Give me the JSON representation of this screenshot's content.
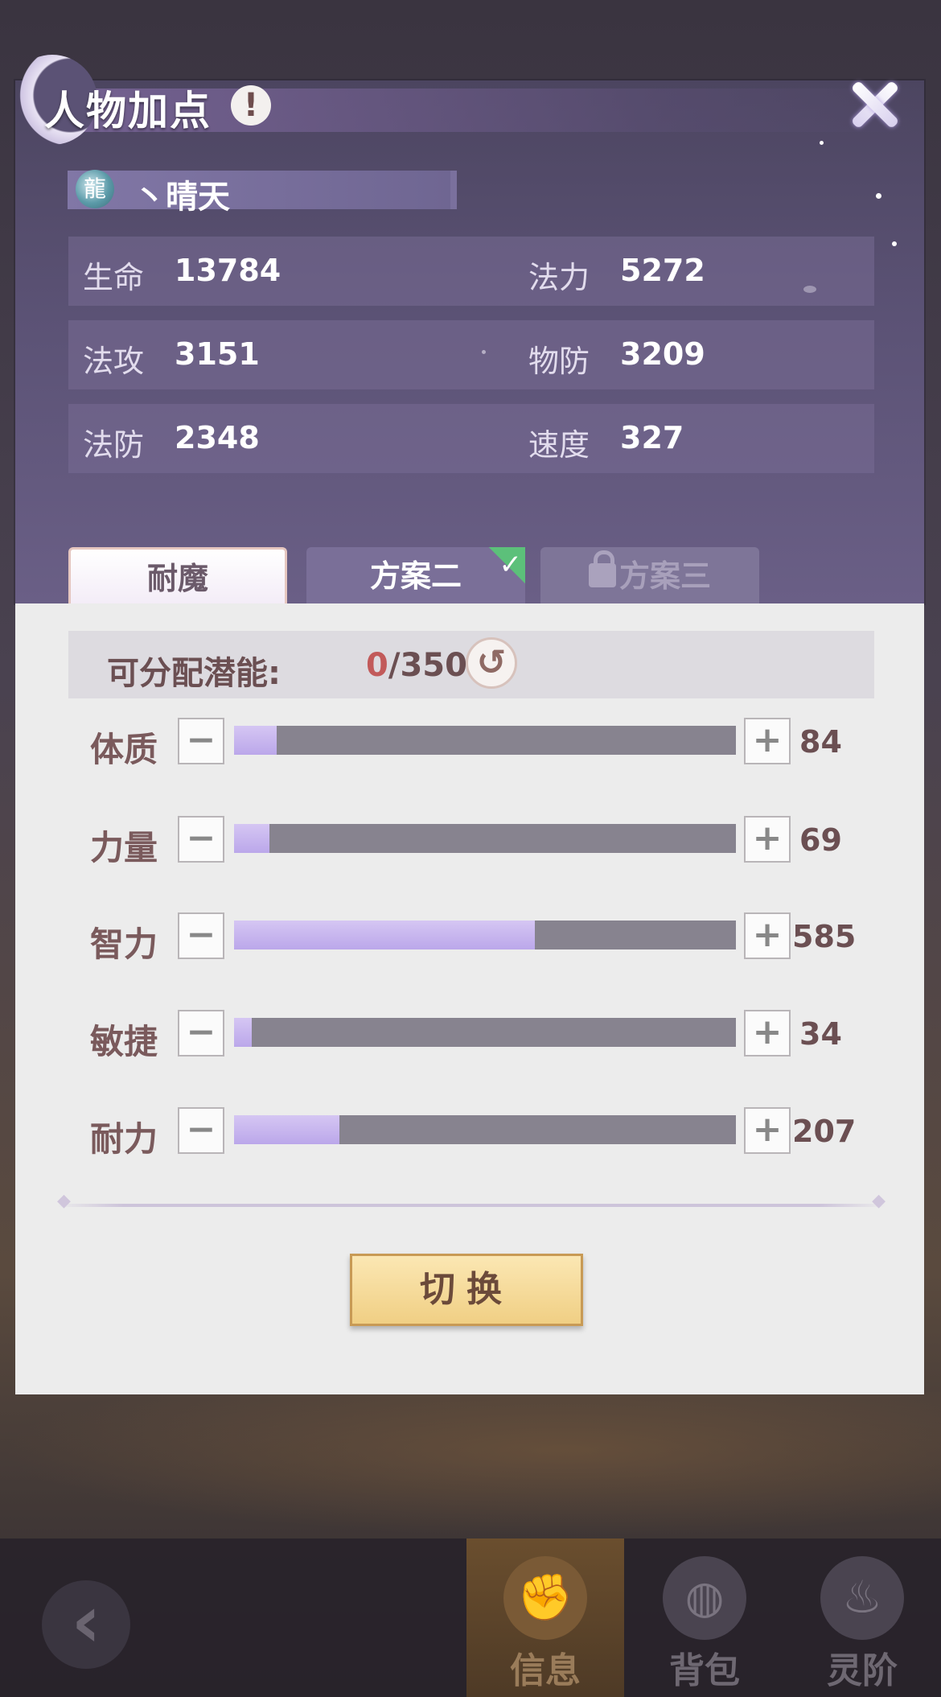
{
  "panel": {
    "title": "人物加点",
    "warning_glyph": "!",
    "character_name": "丶晴天"
  },
  "stats": [
    {
      "label": "生命",
      "value": "13784"
    },
    {
      "label": "法力",
      "value": "5272"
    },
    {
      "label": "法攻",
      "value": "3151"
    },
    {
      "label": "物防",
      "value": "3209"
    },
    {
      "label": "法防",
      "value": "2348"
    },
    {
      "label": "速度",
      "value": "327"
    }
  ],
  "tabs": [
    {
      "label": "耐魔",
      "state": "selected"
    },
    {
      "label": "方案二",
      "state": "checked"
    },
    {
      "label": "方案三",
      "state": "locked"
    }
  ],
  "potential": {
    "label": "可分配潜能:",
    "current": "0",
    "total": "/350"
  },
  "attributes": [
    {
      "label": "体质",
      "value": "84",
      "fill": 0.085
    },
    {
      "label": "力量",
      "value": "69",
      "fill": 0.07
    },
    {
      "label": "智力",
      "value": "585",
      "fill": 0.6
    },
    {
      "label": "敏捷",
      "value": "34",
      "fill": 0.035
    },
    {
      "label": "耐力",
      "value": "207",
      "fill": 0.21
    }
  ],
  "controls": {
    "minus": "−",
    "plus": "+",
    "reset": "↺",
    "switch_label": "切换"
  },
  "nav": {
    "items": [
      {
        "label": "信息",
        "icon": "fist-icon",
        "active": true
      },
      {
        "label": "背包",
        "icon": "bag-icon",
        "active": false
      },
      {
        "label": "灵阶",
        "icon": "flame-icon",
        "active": false
      }
    ]
  },
  "colors": {
    "accent_fill": "#bba7ea",
    "potential_current": "#c25a5a",
    "check_green": "#5cc07a"
  }
}
